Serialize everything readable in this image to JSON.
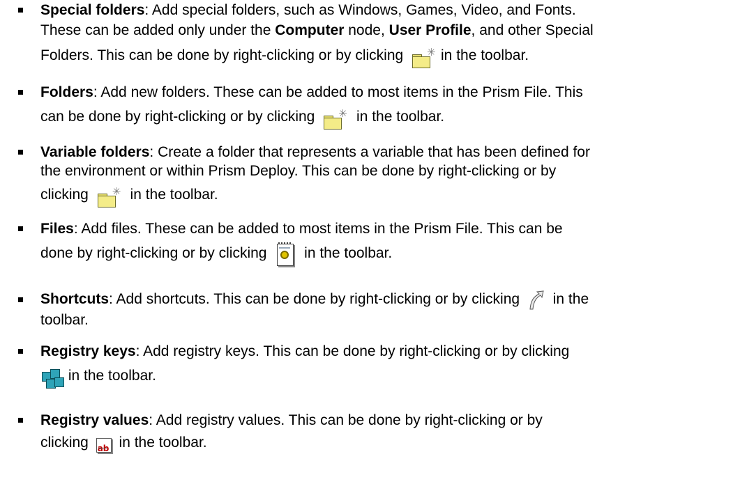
{
  "items": [
    {
      "term": "Special folders",
      "lines": [
        ": Add special folders, such as Windows, Games, Video, and Fonts.",
        "These can be added only under the ",
        " node, ",
        ", and other Special",
        "Folders. This can be done by right-clicking or by clicking ",
        "in the toolbar."
      ],
      "keywords": [
        "Computer",
        "User Profile"
      ],
      "icon": "folder-new-icon"
    },
    {
      "term": "Folders",
      "lines": [
        ": Add new folders. These can be added to most items in the Prism File. This",
        "can be done by right-clicking or by clicking ",
        " in the toolbar."
      ],
      "icon": "folder-new-icon"
    },
    {
      "term": "Variable folders",
      "lines": [
        ": Create a folder that represents a variable that has been defined for",
        "the environment or within Prism Deploy. This can be done by right-clicking or by",
        "clicking ",
        " in the toolbar."
      ],
      "icon": "folder-new-icon"
    },
    {
      "term": "Files",
      "lines": [
        ": Add files. These can be added to most items in the Prism File. This can be",
        "done by right-clicking or by clicking ",
        " in the toolbar."
      ],
      "icon": "file-icon"
    },
    {
      "term": "Shortcuts",
      "lines": [
        ": Add shortcuts. This can be done by right-clicking or by clicking ",
        " in the",
        "toolbar."
      ],
      "icon": "shortcut-icon"
    },
    {
      "term": "Registry keys",
      "lines": [
        ": Add registry keys. This can be done by right-clicking or by clicking",
        " in the toolbar."
      ],
      "icon": "registry-key-icon"
    },
    {
      "term": "Registry values",
      "lines": [
        ": Add registry values. This can be done by right-clicking or by",
        "clicking ",
        " in the toolbar."
      ],
      "icon": "registry-value-icon"
    }
  ]
}
